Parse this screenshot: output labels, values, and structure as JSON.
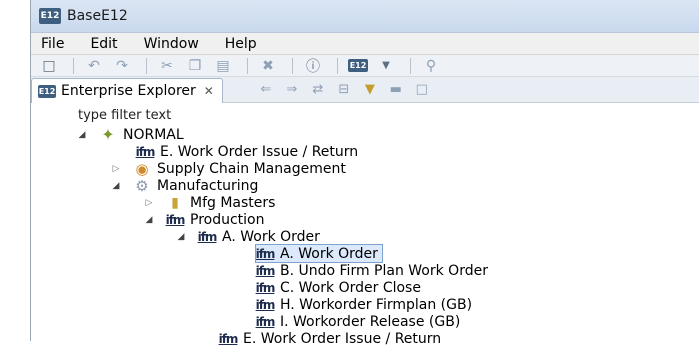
{
  "window": {
    "title": "BaseE12",
    "app_icon_text": "E12"
  },
  "menu": [
    "File",
    "Edit",
    "Window",
    "Help"
  ],
  "toolbar": {
    "icons": [
      "new-icon",
      "back-icon",
      "forward-icon",
      "cut-icon",
      "copy-icon",
      "paste-icon",
      "delete-icon",
      "help-icon",
      "perspective-icon",
      "dropdown-icon",
      "search-icon"
    ]
  },
  "view": {
    "tab_label": "Enterprise Explorer",
    "tools": [
      "back-nav-icon",
      "forward-nav-icon",
      "link-icon",
      "collapse-icon",
      "view-menu-icon",
      "minimize-icon",
      "maximize-icon"
    ]
  },
  "filter": {
    "text": "type filter text"
  },
  "tree": [
    {
      "label": "NORMAL",
      "icon": "normal-icon",
      "expanded": true
    },
    {
      "label": "E. Work Order Issue / Return",
      "icon": "ifm-icon"
    },
    {
      "label": "Supply Chain Management",
      "icon": "supply-chain-icon",
      "expanded": false
    },
    {
      "label": "Manufacturing",
      "icon": "gear-icon",
      "expanded": true
    },
    {
      "label": "Mfg Masters",
      "icon": "book-icon",
      "expanded": false
    },
    {
      "label": "Production",
      "icon": "ifm-icon",
      "expanded": true
    },
    {
      "label": "A. Work Order",
      "icon": "ifm-icon",
      "expanded": true
    },
    {
      "label": "A. Work Order",
      "icon": "ifm-icon",
      "selected": true
    },
    {
      "label": "B. Undo Firm Plan Work Order",
      "icon": "ifm-icon"
    },
    {
      "label": "C. Work Order Close",
      "icon": "ifm-icon"
    },
    {
      "label": "H. Workorder Firmplan (GB)",
      "icon": "ifm-icon"
    },
    {
      "label": "I. Workorder Release (GB)",
      "icon": "ifm-icon"
    },
    {
      "label": "E. Work Order Issue / Return",
      "icon": "ifm-icon"
    }
  ],
  "ifm_glyph": "ifm"
}
